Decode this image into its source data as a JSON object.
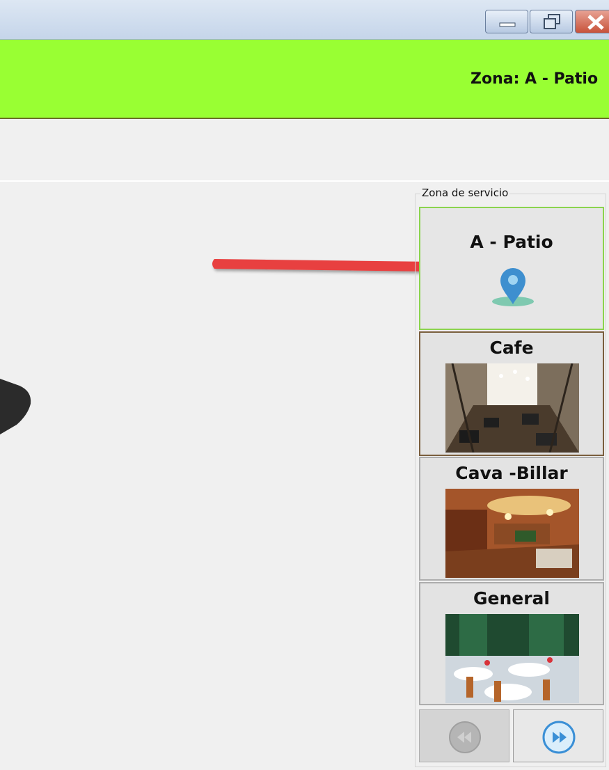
{
  "header": {
    "zone_title": "Zona: A - Patio"
  },
  "service_zone": {
    "legend": "Zona de servicio",
    "zones": [
      {
        "label": "A - Patio",
        "icon": "location-pin-icon",
        "selected": true
      },
      {
        "label": "Cafe",
        "image": "cafe-photo"
      },
      {
        "label": "Cava -Billar",
        "image": "billiard-room-photo"
      },
      {
        "label": "General",
        "image": "dining-hall-photo"
      }
    ]
  },
  "navigation": {
    "prev_icon": "rewind-icon",
    "next_icon": "fast-forward-icon"
  },
  "colors": {
    "header_bg": "#99ff33",
    "selected_border": "#8bd44e",
    "annotation_arrow": "#e8413f"
  }
}
